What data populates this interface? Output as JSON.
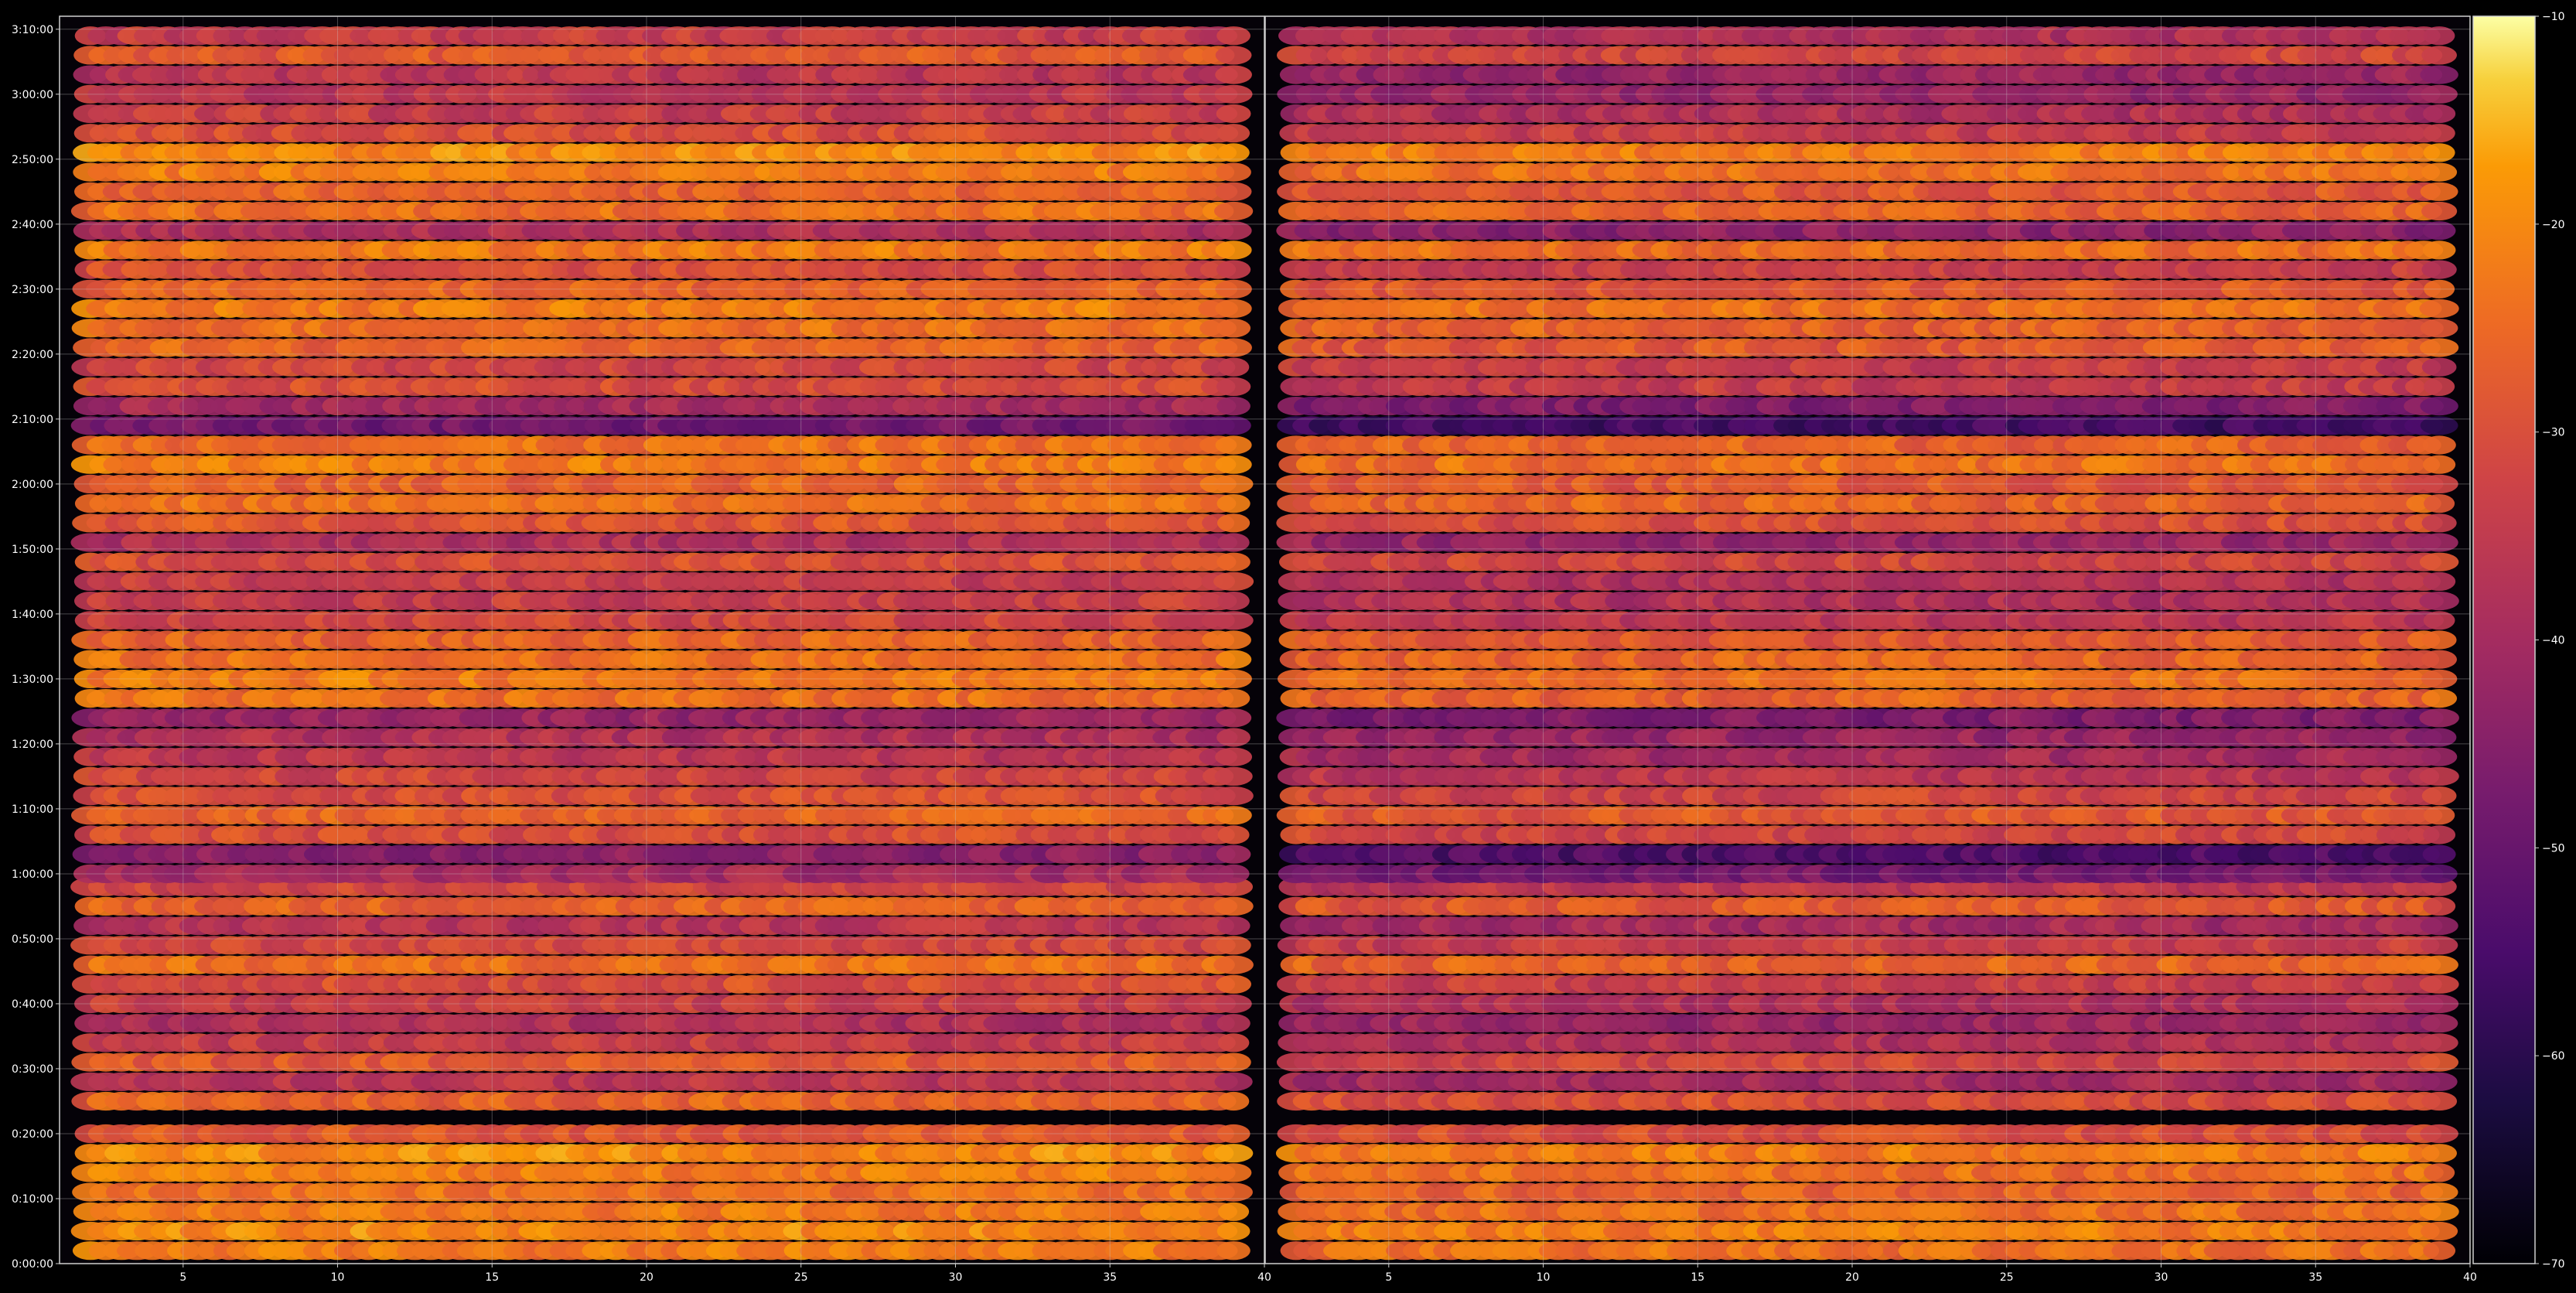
{
  "chart_data": {
    "type": "heatmap",
    "title": "",
    "xlabel": "",
    "ylabel": "",
    "grid": true,
    "colormap": "inferno",
    "background": "#000000",
    "grid_color": "#cccccc",
    "panels": [
      {
        "name": "",
        "xlim": [
          1,
          40
        ],
        "x_ticks": [
          5,
          10,
          15,
          20,
          25,
          30,
          35,
          40
        ]
      },
      {
        "name": "",
        "xlim": [
          1,
          40
        ],
        "x_ticks": [
          5,
          10,
          15,
          20,
          25,
          30,
          35,
          40
        ]
      }
    ],
    "ylim_seconds": [
      0,
      11520
    ],
    "y_ticks": [
      "0:00:00",
      "0:10:00",
      "0:20:00",
      "0:30:00",
      "0:40:00",
      "0:50:00",
      "1:00:00",
      "1:10:00",
      "1:20:00",
      "1:30:00",
      "1:40:00",
      "1:50:00",
      "2:00:00",
      "2:10:00",
      "2:20:00",
      "2:30:00",
      "2:40:00",
      "2:50:00",
      "3:00:00",
      "3:10:00"
    ],
    "colorbar": {
      "range": [
        -70,
        -10
      ],
      "ticks": [
        -70,
        -60,
        -50,
        -40,
        -30,
        -20,
        -10
      ]
    },
    "row_profile": {
      "note_units": "time in seconds vs approximate level in colorbar units",
      "time_s": [
        120,
        300,
        480,
        660,
        840,
        1020,
        1200,
        1500,
        1680,
        1860,
        2040,
        2220,
        2400,
        2580,
        2760,
        2940,
        3120,
        3300,
        3480,
        3600,
        3780,
        3960,
        4140,
        4320,
        4500,
        4680,
        4860,
        5040,
        5220,
        5400,
        5580,
        5760,
        5940,
        6120,
        6300,
        6480,
        6660,
        6840,
        7020,
        7200,
        7380,
        7560,
        7740,
        7920,
        8100,
        8280,
        8460,
        8640,
        8820,
        9000,
        9180,
        9360,
        9540,
        9720,
        9900,
        10080,
        10260,
        10440,
        10620,
        10800,
        10980,
        11160,
        11340
      ],
      "level_panel1": [
        -22,
        -20,
        -22,
        -24,
        -22,
        -20,
        -28,
        -26,
        -36,
        -28,
        -34,
        -38,
        -34,
        -30,
        -24,
        -32,
        -36,
        -26,
        -32,
        -40,
        -44,
        -30,
        -26,
        -30,
        -32,
        -36,
        -38,
        -42,
        -24,
        -22,
        -24,
        -26,
        -32,
        -34,
        -34,
        -30,
        -38,
        -28,
        -24,
        -26,
        -22,
        -24,
        -48,
        -40,
        -30,
        -32,
        -26,
        -24,
        -22,
        -26,
        -30,
        -22,
        -38,
        -24,
        -26,
        -22,
        -20,
        -30,
        -34,
        -36,
        -36,
        -28,
        -34
      ],
      "level_panel2": [
        -24,
        -22,
        -24,
        -26,
        -24,
        -22,
        -30,
        -30,
        -40,
        -32,
        -38,
        -42,
        -38,
        -34,
        -26,
        -34,
        -40,
        -28,
        -36,
        -48,
        -54,
        -32,
        -28,
        -32,
        -36,
        -40,
        -42,
        -46,
        -26,
        -24,
        -26,
        -28,
        -36,
        -38,
        -38,
        -32,
        -42,
        -30,
        -26,
        -28,
        -24,
        -26,
        -56,
        -46,
        -34,
        -34,
        -28,
        -26,
        -24,
        -28,
        -34,
        -24,
        -44,
        -26,
        -28,
        -24,
        -22,
        -34,
        -38,
        -42,
        -42,
        -32,
        -38
      ]
    }
  }
}
